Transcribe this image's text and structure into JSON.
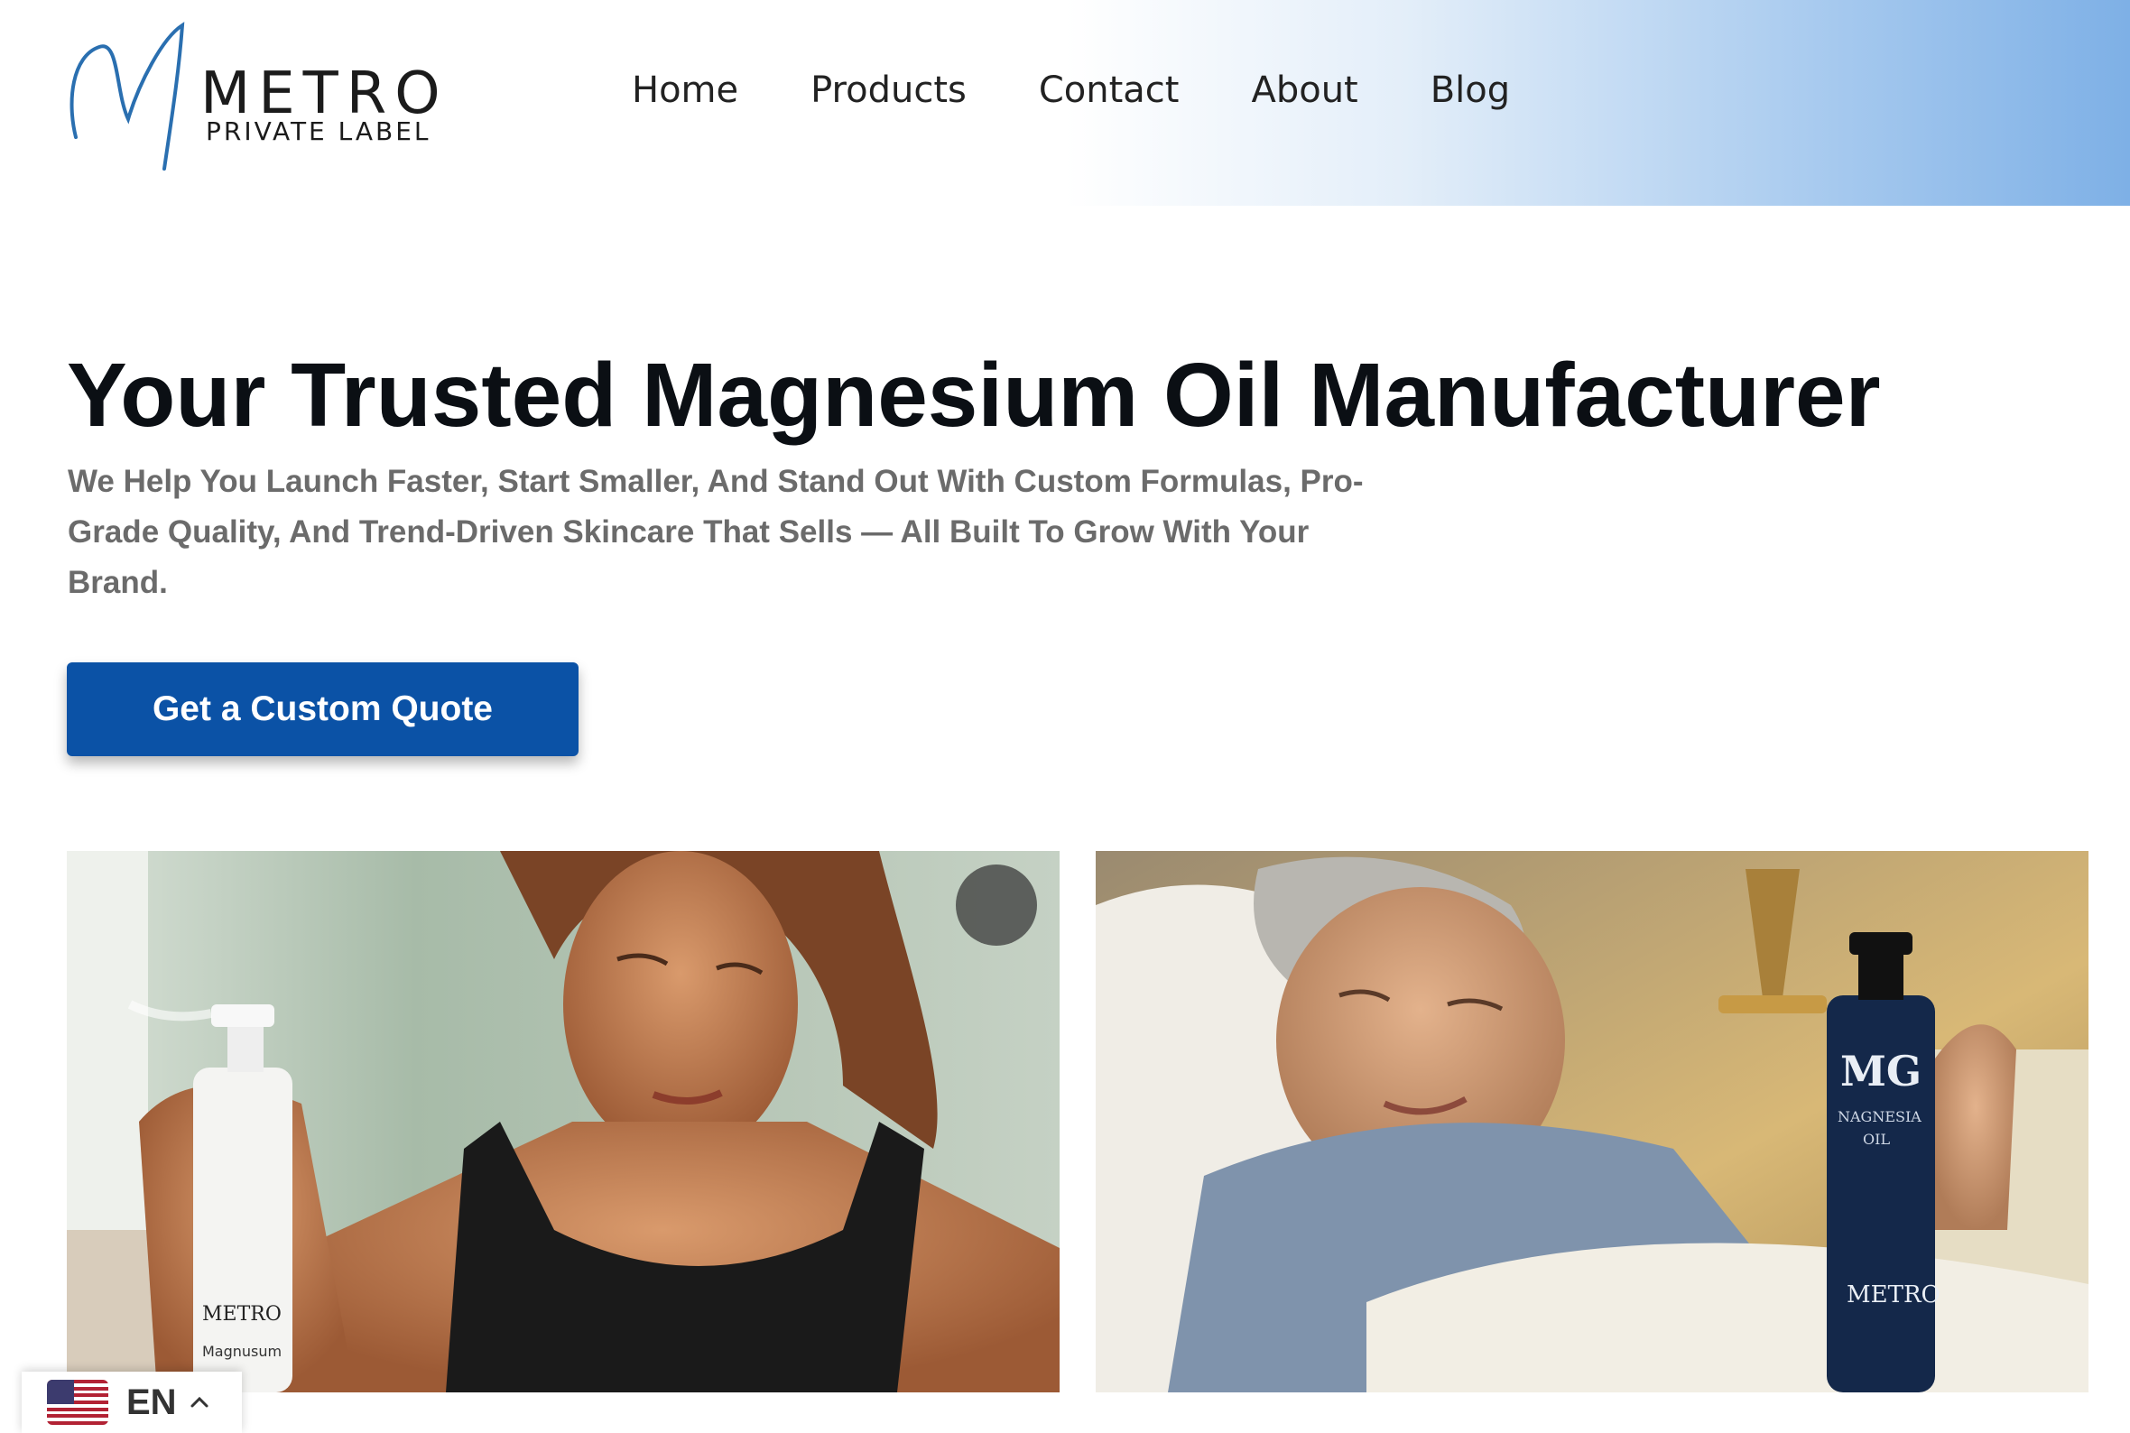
{
  "brand": {
    "name": "METRO",
    "tagline": "PRIVATE LABEL",
    "logo_color": "#2a6fb0"
  },
  "nav": {
    "items": [
      "Home",
      "Products",
      "Contact",
      "About",
      "Blog"
    ]
  },
  "hero": {
    "title": "Your Trusted Magnesium Oil Manufacturer",
    "subtitle": "We Help You Launch Faster, Start Smaller, And Stand Out With Custom Formulas, Pro-Grade Quality, And Trend-Driven Skincare That Sells — All Built To Grow With Your Brand.",
    "cta_label": "Get a Custom Quote",
    "cta_color": "#0b52a6"
  },
  "images": [
    {
      "name": "athlete-spraying-magnesium-oil",
      "bottle_text": "METRO",
      "bottle_subtext": "Magnusum"
    },
    {
      "name": "woman-resting-with-magnesium-oil",
      "bottle_text": "MG",
      "bottle_subtext": "NAGNESIA OIL",
      "bottle_brand": "METRO"
    }
  ],
  "language": {
    "code": "EN",
    "flag": "us-flag-icon"
  }
}
